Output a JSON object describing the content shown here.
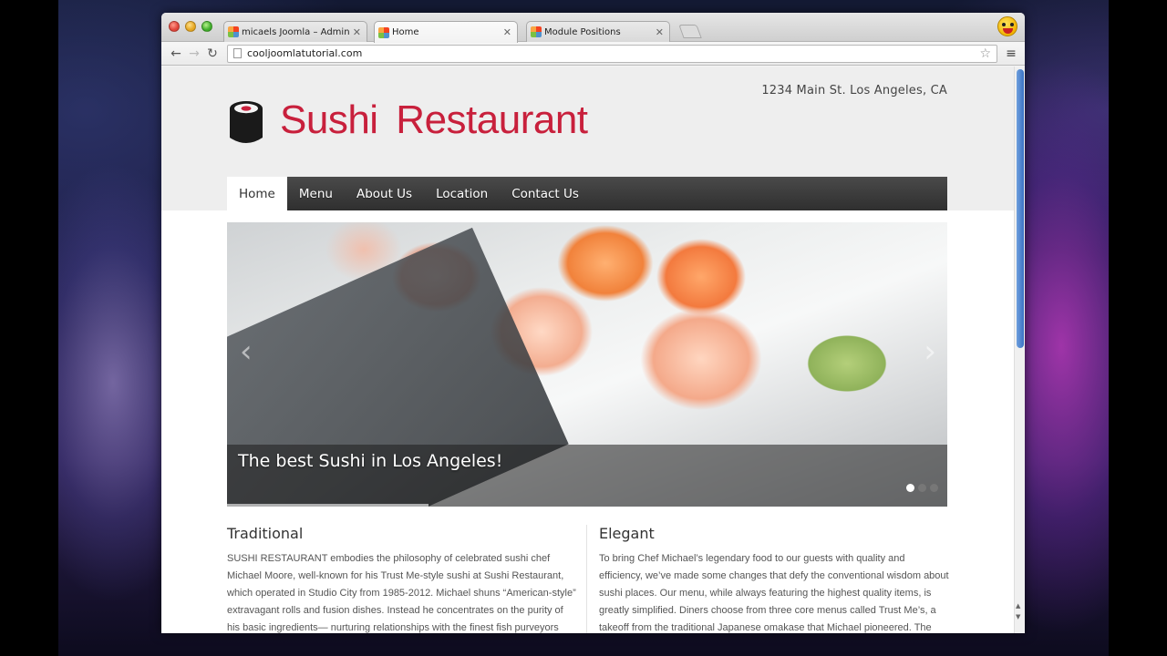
{
  "browser": {
    "tabs": [
      {
        "title": "micaels Joomla – Administra",
        "active": false
      },
      {
        "title": "Home",
        "active": true
      },
      {
        "title": "Module Positions",
        "active": false
      }
    ],
    "url": "cooljoomlatutorial.com"
  },
  "site": {
    "address": "1234 Main St. Los Angeles, CA",
    "logo_text": "Sushi Restaurant",
    "brand_color": "#c8203c",
    "nav": [
      {
        "label": "Home",
        "active": true
      },
      {
        "label": "Menu",
        "active": false
      },
      {
        "label": "About Us",
        "active": false
      },
      {
        "label": "Location",
        "active": false
      },
      {
        "label": "Contact Us",
        "active": false
      }
    ],
    "slider": {
      "caption": "The best Sushi in Los Angeles!",
      "slide_count": 3,
      "active_slide": 1,
      "progress": 0.28
    },
    "columns": [
      {
        "heading": "Traditional",
        "body": "SUSHI RESTAURANT embodies the philosophy of celebrated sushi chef Michael Moore, well-known for his Trust Me-style sushi at Sushi Restaurant, which operated in Studio City from 1985-2012. Michael shuns “American-style” extravagant rolls and fusion dishes. Instead he concentrates on the purity of his basic ingredients— nurturing relationships with the finest fish purveyors across"
      },
      {
        "heading": "Elegant",
        "body": "To bring Chef Michael’s legendary food to our guests with quality and efficiency, we’ve made some changes that defy the conventional wisdom about sushi places. Our menu, while always featuring the highest quality items, is greatly simplified. Diners choose from three core menus called Trust Me’s, a takeoff from the traditional Japanese omakase that Michael pioneered. The biggest"
      }
    ]
  }
}
